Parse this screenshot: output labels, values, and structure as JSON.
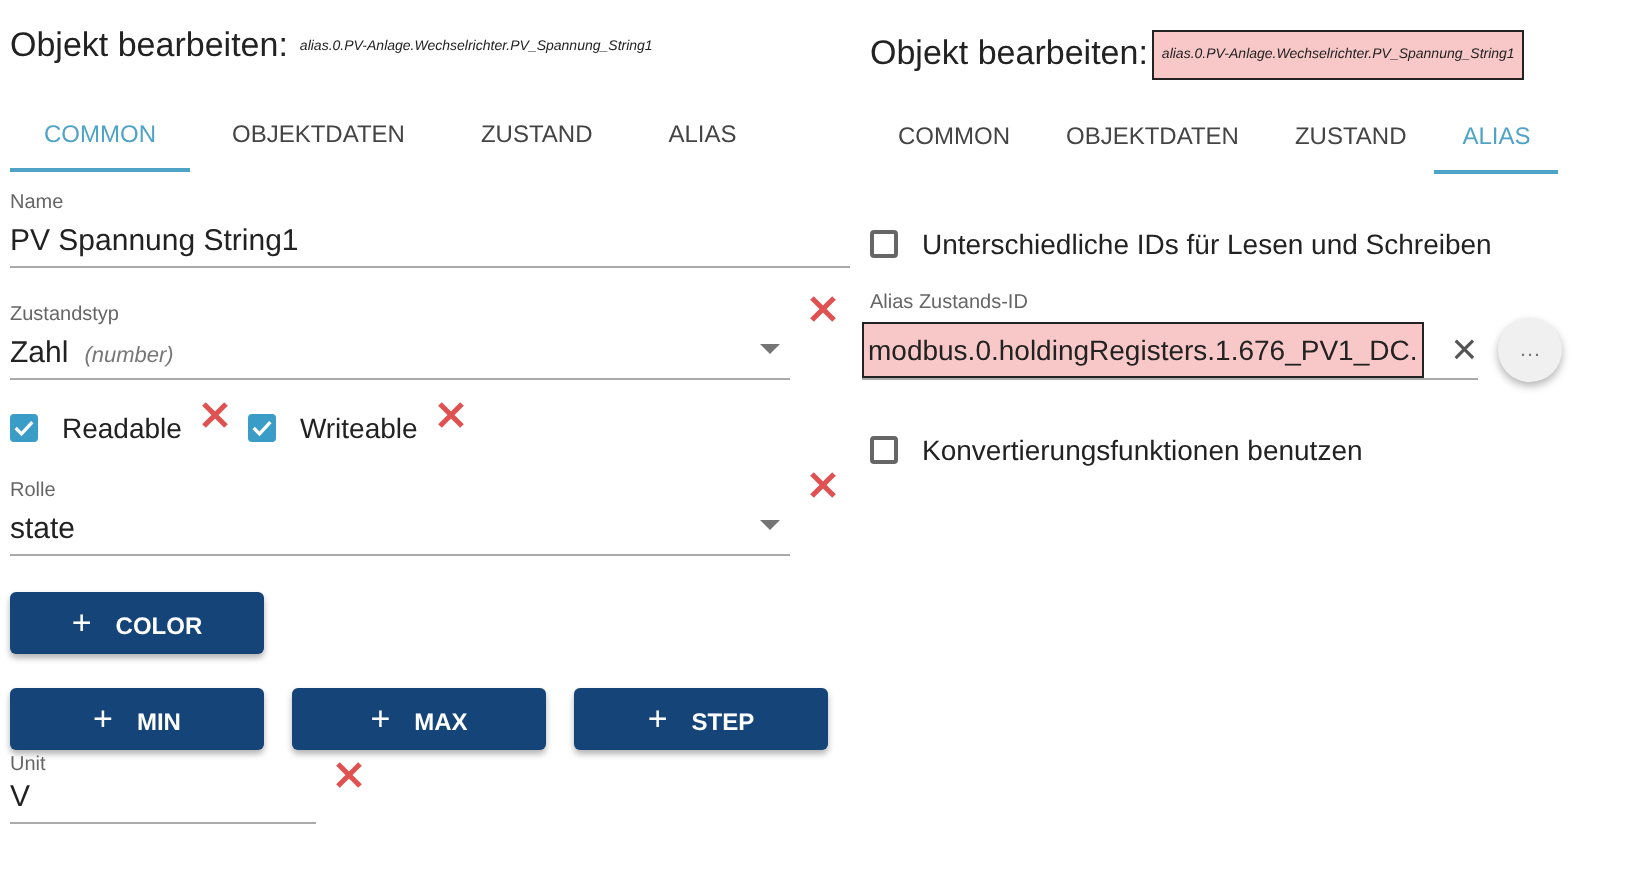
{
  "panels": [
    {
      "title": "Objekt bearbeiten:",
      "object_id": "alias.0.PV-Anlage.Wechselrichter.PV_Spannung_String1",
      "object_id_highlighted": false,
      "tabs": [
        {
          "label": "COMMON",
          "selected": true
        },
        {
          "label": "OBJEKTDATEN",
          "selected": false
        },
        {
          "label": "ZUSTAND",
          "selected": false
        },
        {
          "label": "ALIAS",
          "selected": false
        }
      ],
      "rows": [
        {
          "kind": "field",
          "label": "Name",
          "value": "PV Spannung String1",
          "removable": false,
          "dropdown": false
        },
        {
          "kind": "field",
          "label": "Zustandstyp",
          "value": "Zahl",
          "hint": "(number)",
          "removable": true,
          "dropdown": true
        },
        {
          "kind": "checks",
          "items": [
            {
              "label": "Readable",
              "checked": true,
              "removable": true
            },
            {
              "label": "Writeable",
              "checked": true,
              "removable": true
            }
          ]
        },
        {
          "kind": "field",
          "label": "Rolle",
          "value": "state",
          "removable": true,
          "dropdown": true
        },
        {
          "kind": "buttons",
          "items": [
            {
              "icon": "+",
              "label": "COLOR"
            }
          ]
        },
        {
          "kind": "buttons",
          "items": [
            {
              "icon": "+",
              "label": "MIN"
            },
            {
              "icon": "+",
              "label": "MAX"
            },
            {
              "icon": "+",
              "label": "STEP"
            }
          ]
        },
        {
          "kind": "unit",
          "label": "Unit",
          "value": "V",
          "removable": true
        }
      ]
    },
    {
      "title": "Objekt bearbeiten:",
      "object_id": "alias.0.PV-Anlage.Wechselrichter.PV_Spannung_String1",
      "object_id_highlighted": true,
      "tabs": [
        {
          "label": "COMMON",
          "selected": false
        },
        {
          "label": "OBJEKTDATEN",
          "selected": false
        },
        {
          "label": "ZUSTAND",
          "selected": false
        },
        {
          "label": "ALIAS",
          "selected": true
        }
      ],
      "rows": [
        {
          "kind": "checkbox",
          "label": "Unterschiedliche IDs für Lesen und Schreiben",
          "checked": false
        },
        {
          "kind": "idfield",
          "label": "Alias Zustands-ID",
          "value": "modbus.0.holdingRegisters.1.676_PV1_DC.",
          "highlighted": true,
          "clear_icon": "×",
          "more_icon": "…"
        },
        {
          "kind": "checkbox",
          "label": "Konvertierungsfunktionen benutzen",
          "checked": false
        }
      ]
    }
  ]
}
